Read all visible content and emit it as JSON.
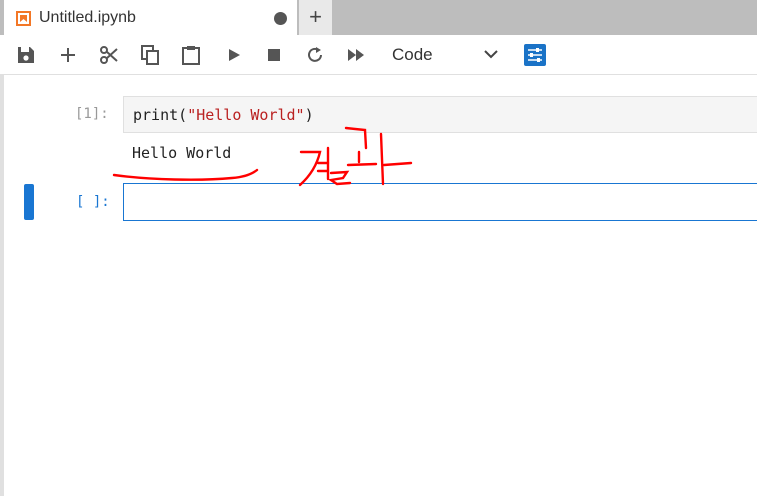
{
  "tab": {
    "title": "Untitled.ipynb",
    "new_tab_label": "+"
  },
  "toolbar": {
    "buttons": [
      "save-icon",
      "add-cell-icon",
      "cut-icon",
      "copy-icon",
      "paste-icon",
      "run-icon",
      "stop-icon",
      "restart-icon",
      "fast-forward-icon"
    ],
    "cell_type": "Code"
  },
  "cells": [
    {
      "prompt": "[1]:",
      "code_prefix": "print(",
      "code_string": "\"Hello World\"",
      "code_suffix": ")",
      "output": "Hello World"
    },
    {
      "prompt": "[ ]:",
      "code": ""
    }
  ],
  "annotation": {
    "handwritten_text": "결과",
    "color": "#ff0000"
  },
  "colors": {
    "accent": "#1976d2",
    "tab_icon": "#f37726",
    "string": "#ba2121"
  }
}
